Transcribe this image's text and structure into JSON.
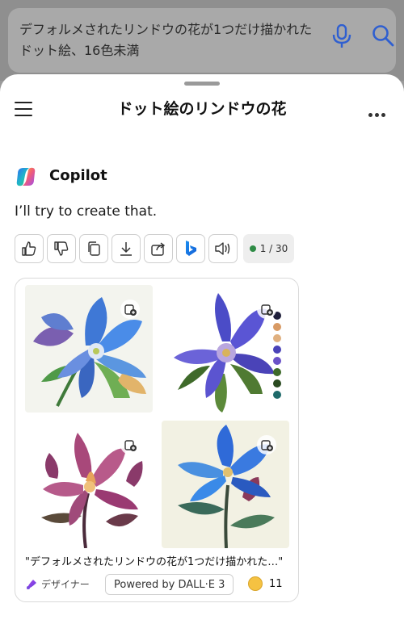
{
  "search": {
    "query": "デフォルメされたリンドウの花が1つだけ描かれたドット絵、16色未満"
  },
  "header": {
    "title": "ドット絵のリンドウの花"
  },
  "assistant": {
    "name": "Copilot",
    "reply": "I’ll try to create that."
  },
  "toolbar": {
    "icons": [
      "thumbs-up-icon",
      "thumbs-down-icon",
      "copy-icon",
      "download-icon",
      "share-icon",
      "bing-icon",
      "speaker-icon"
    ],
    "counter": "1 / 30",
    "counter_dot_color": "#2e8b45"
  },
  "result_card": {
    "caption": "\"デフォルメされたリンドウの花が1つだけ描かれた…\"",
    "designer_label": "デザイナー",
    "powered_by": "Powered by DALL·E 3",
    "boost_count": "11",
    "images": [
      {
        "subject": "blue gentian flower with leaves"
      },
      {
        "subject": "purple gentian flower with color palette"
      },
      {
        "subject": "magenta gentian flowers"
      },
      {
        "subject": "blue gentian flower on stem"
      }
    ]
  },
  "colors": {
    "accent_blue": "#2f5fd0",
    "sheet_bg": "#ffffff",
    "overlay": "#9a9a9a"
  }
}
